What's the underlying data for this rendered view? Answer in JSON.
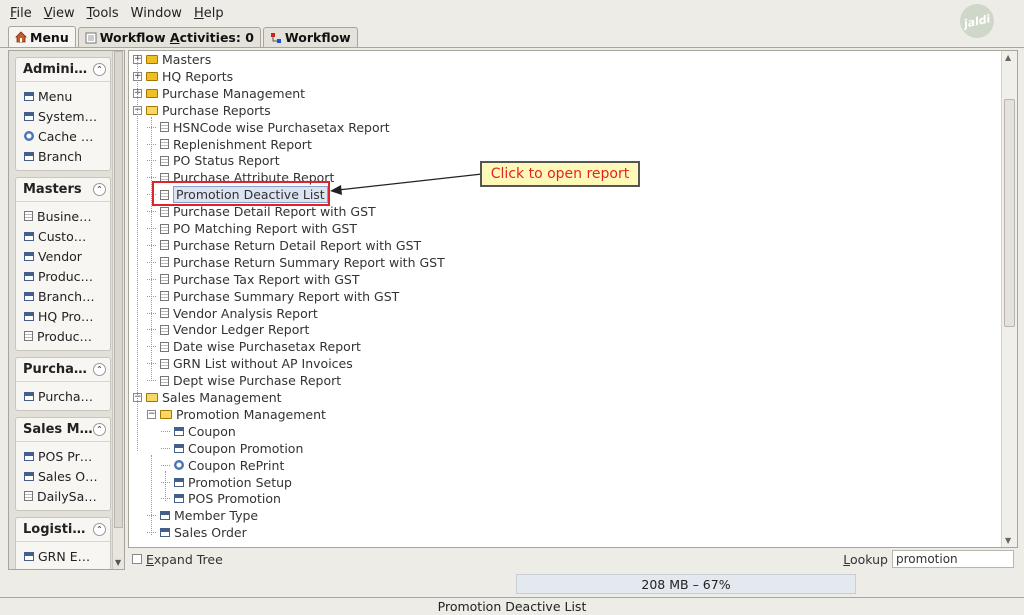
{
  "menu": {
    "items": [
      {
        "label_pre": "",
        "mnemonic": "F",
        "label_post": "ile"
      },
      {
        "label_pre": "",
        "mnemonic": "V",
        "label_post": "iew"
      },
      {
        "label_pre": "",
        "mnemonic": "T",
        "label_post": "ools"
      },
      {
        "label_pre": "Window",
        "mnemonic": "",
        "label_post": ""
      },
      {
        "label_pre": "",
        "mnemonic": "H",
        "label_post": "elp"
      }
    ]
  },
  "logo": {
    "text": "jaldi"
  },
  "tabs": {
    "menu": {
      "label": "Menu"
    },
    "activities": {
      "label_pre": "Workflow ",
      "mnemonic": "A",
      "label_post": "ctivities: 0"
    },
    "workflow": {
      "label": "Workflow"
    }
  },
  "sidebar": {
    "groups": [
      {
        "title": "Admini…",
        "items": [
          {
            "label": "Menu",
            "icon": "window-icon"
          },
          {
            "label": "System…",
            "icon": "window-icon"
          },
          {
            "label": "Cache …",
            "icon": "gear-icon"
          },
          {
            "label": "Branch",
            "icon": "window-icon"
          }
        ]
      },
      {
        "title": "Masters",
        "items": [
          {
            "label": "Busine…",
            "icon": "document-icon"
          },
          {
            "label": "Custo…",
            "icon": "window-icon"
          },
          {
            "label": "Vendor",
            "icon": "window-icon"
          },
          {
            "label": "Produc…",
            "icon": "window-icon"
          },
          {
            "label": "Branch…",
            "icon": "window-icon"
          },
          {
            "label": "HQ Pro…",
            "icon": "window-icon"
          },
          {
            "label": "Produc…",
            "icon": "document-icon"
          }
        ]
      },
      {
        "title": "Purcha…",
        "items": [
          {
            "label": "Purcha…",
            "icon": "window-icon"
          }
        ]
      },
      {
        "title": "Sales M…",
        "items": [
          {
            "label": "POS Pr…",
            "icon": "window-icon"
          },
          {
            "label": "Sales O…",
            "icon": "window-icon"
          },
          {
            "label": "DailySa…",
            "icon": "document-icon"
          }
        ]
      },
      {
        "title": "Logisti…",
        "items": [
          {
            "label": "GRN E…",
            "icon": "window-icon"
          }
        ]
      }
    ]
  },
  "tree": {
    "nodes": [
      {
        "label": "Masters",
        "type": "folder-closed",
        "expander": "+"
      },
      {
        "label": "HQ Reports",
        "type": "folder-closed",
        "expander": "+"
      },
      {
        "label": "Purchase Management",
        "type": "folder-closed",
        "expander": "+"
      },
      {
        "label": "Purchase Reports",
        "type": "folder-open",
        "expander": "-"
      },
      {
        "label": "HSNCode wise Purchasetax Report",
        "type": "report"
      },
      {
        "label": "Replenishment Report",
        "type": "report"
      },
      {
        "label": "PO Status Report",
        "type": "report"
      },
      {
        "label": "Purchase Attribute Report",
        "type": "report"
      },
      {
        "label": "Promotion Deactive List",
        "type": "report",
        "selected": true
      },
      {
        "label": "Purchase Detail Report with GST",
        "type": "report"
      },
      {
        "label": "PO Matching Report with GST",
        "type": "report"
      },
      {
        "label": "Purchase Return Detail Report with GST",
        "type": "report"
      },
      {
        "label": "Purchase Return Summary Report with GST",
        "type": "report"
      },
      {
        "label": "Purchase Tax Report with GST",
        "type": "report"
      },
      {
        "label": "Purchase Summary Report with GST",
        "type": "report"
      },
      {
        "label": "Vendor Analysis Report",
        "type": "report"
      },
      {
        "label": "Vendor Ledger Report",
        "type": "report"
      },
      {
        "label": "Date wise Purchasetax Report",
        "type": "report"
      },
      {
        "label": "GRN List without AP Invoices",
        "type": "report"
      },
      {
        "label": "Dept wise Purchase Report",
        "type": "report"
      },
      {
        "label": "Sales Management",
        "type": "folder-open",
        "expander": "-"
      },
      {
        "label": "Promotion Management",
        "type": "folder-open",
        "expander": "-"
      },
      {
        "label": "Coupon",
        "type": "window"
      },
      {
        "label": "Coupon Promotion",
        "type": "window"
      },
      {
        "label": "Coupon RePrint",
        "type": "process"
      },
      {
        "label": "Promotion Setup",
        "type": "window"
      },
      {
        "label": "POS Promotion",
        "type": "window"
      },
      {
        "label": "Member Type",
        "type": "window"
      },
      {
        "label": "Sales Order",
        "type": "window"
      }
    ]
  },
  "annotation": {
    "callout_text": "Click to open report"
  },
  "bottom": {
    "expand_tree_label_pre": "",
    "expand_tree_mnemonic": "E",
    "expand_tree_label_post": "xpand Tree",
    "lookup_label_pre": "",
    "lookup_mnemonic": "L",
    "lookup_label_post": "ookup",
    "lookup_value": "promotion"
  },
  "memory": {
    "text": "208 MB – 67%"
  },
  "status": {
    "text": "Promotion Deactive List"
  },
  "colors": {
    "accent_red": "#e0232b",
    "callout_bg": "#fff9b8",
    "selection": "#dbe4f2"
  }
}
